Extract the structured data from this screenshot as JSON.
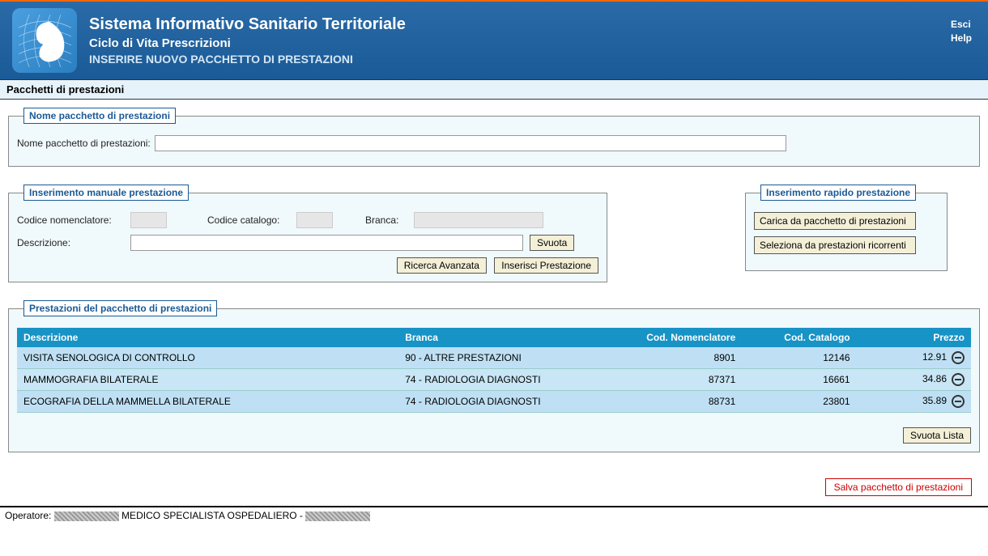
{
  "header": {
    "title": "Sistema Informativo Sanitario Territoriale",
    "subtitle": "Ciclo di Vita Prescrizioni",
    "action_title": "INSERIRE NUOVO PACCHETTO DI PRESTAZIONI",
    "links": {
      "esci": "Esci",
      "help": "Help"
    }
  },
  "section_title": "Pacchetti di prestazioni",
  "nome_pacchetto_box": {
    "legend": "Nome pacchetto di prestazioni",
    "label": "Nome pacchetto di prestazioni:",
    "value": ""
  },
  "manuale_box": {
    "legend": "Inserimento manuale prestazione",
    "codice_nomenclatore_label": "Codice nomenclatore:",
    "codice_nomenclatore_value": "",
    "codice_catalogo_label": "Codice catalogo:",
    "codice_catalogo_value": "",
    "branca_label": "Branca:",
    "branca_value": "",
    "descrizione_label": "Descrizione:",
    "descrizione_value": "",
    "btn_svuota": "Svuota",
    "btn_ricerca": "Ricerca Avanzata",
    "btn_inserisci": "Inserisci Prestazione"
  },
  "rapido_box": {
    "legend": "Inserimento rapido prestazione",
    "btn_carica": "Carica da pacchetto di prestazioni",
    "btn_ricorrenti": "Seleziona da prestazioni ricorrenti"
  },
  "prestazioni_box": {
    "legend": "Prestazioni del pacchetto di prestazioni",
    "columns": {
      "descrizione": "Descrizione",
      "branca": "Branca",
      "cod_nomenclatore": "Cod. Nomenclatore",
      "cod_catalogo": "Cod. Catalogo",
      "prezzo": "Prezzo"
    },
    "rows": [
      {
        "descrizione": "VISITA SENOLOGICA DI CONTROLLO",
        "branca": "90 - ALTRE PRESTAZIONI",
        "cod_nomenclatore": "8901",
        "cod_catalogo": "12146",
        "prezzo": "12.91"
      },
      {
        "descrizione": "MAMMOGRAFIA BILATERALE",
        "branca": "74 - RADIOLOGIA DIAGNOSTI",
        "cod_nomenclatore": "87371",
        "cod_catalogo": "16661",
        "prezzo": "34.86"
      },
      {
        "descrizione": "ECOGRAFIA DELLA MAMMELLA BILATERALE",
        "branca": "74 - RADIOLOGIA DIAGNOSTI",
        "cod_nomenclatore": "88731",
        "cod_catalogo": "23801",
        "prezzo": "35.89"
      }
    ],
    "btn_svuota_lista": "Svuota Lista"
  },
  "btn_salva": "Salva pacchetto di prestazioni",
  "footer": {
    "operatore_label": "Operatore:",
    "role": "MEDICO SPECIALISTA OSPEDALIERO -"
  }
}
